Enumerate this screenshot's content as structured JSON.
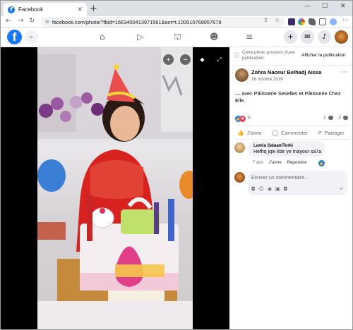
{
  "browser": {
    "tab_title": "Facebook",
    "url": "facebook.com/photo/?fbid=1663400413971561&set=t.100010768057678"
  },
  "icons": {
    "tab_favicon": "facebook-f-icon",
    "tab_favicon_glyph": "f",
    "close_glyph": "✕",
    "newtab_glyph": "+",
    "minimize_glyph": "—",
    "maximize_glyph": "☐",
    "back_glyph": "←",
    "forward_glyph": "→",
    "reload_glyph": "↻",
    "lock_glyph": "⊝",
    "share_glyph": "⇪",
    "star_glyph": "☆",
    "fb_logo_glyph": "f",
    "search_glyph": "⌕",
    "home_glyph": "⌂",
    "video_glyph": "▷",
    "marketplace_glyph": "⛫",
    "groups_glyph": "☻",
    "menu_glyph": "≡",
    "create_glyph": "+",
    "messenger_glyph": "✉",
    "bell_glyph": "♪",
    "zoom_in_glyph": "+",
    "zoom_out_glyph": "−",
    "tag_glyph": "◆",
    "fullscreen_glyph": "⤢",
    "globe_glyph": "ⓘ",
    "more_glyph": "···",
    "like_glyph": "👍",
    "love_glyph": "♥",
    "comment_glyph": "◯",
    "share_action_glyph": "↗",
    "emoji_glyph": "☺",
    "camera_glyph": "◉",
    "gif_glyph": "▣",
    "sticker_glyph": "◘",
    "send_glyph": "➤"
  },
  "colors": {
    "facebook_blue": "#1877f2",
    "love_red": "#f33e58",
    "secondary_text": "#65676b"
  },
  "photo": {
    "description": "birthday-photo",
    "cake_letters": "HAPPY"
  },
  "notice": {
    "text": "Cette photo provient d'une publication.",
    "link": "Afficher la publication"
  },
  "post": {
    "author": "Zohra Naceur Belhadj Aissa",
    "date": "16 octobre 2016 ·",
    "text": "— avec Pâtisserie Seselles et Pâtisserie Chez Elle."
  },
  "reactions": {
    "count": "6",
    "comments": "1",
    "shares": "2"
  },
  "actions": {
    "like": "J'aime",
    "comment": "Commenter",
    "share": "Partager"
  },
  "comment": {
    "name": "Lamia SalaaniTorki",
    "text": "Hefhq jqw kbir ye mayour sa7a",
    "time": "7 ans",
    "like": "J'aime",
    "reply": "Répondre"
  },
  "composer": {
    "placeholder": "Écrivez un commentaire…"
  }
}
